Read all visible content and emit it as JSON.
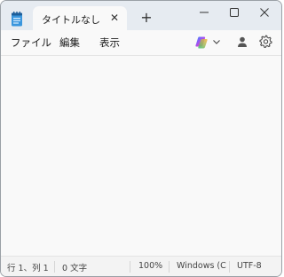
{
  "tab": {
    "title": "タイトルなし",
    "close_glyph": "✕"
  },
  "new_tab_glyph": "+",
  "menu": {
    "file": "ファイル",
    "edit": "編集",
    "view": "表示"
  },
  "status": {
    "position": "行 1、列 1",
    "characters": "0 文字",
    "zoom": "100%",
    "line_ending": "Windows (CR",
    "encoding": "UTF-8"
  },
  "colors": {
    "titlebar": "#e6ebf1",
    "editor_background": "#f9f9f9",
    "statusbar": "#f3f3f3",
    "app_icon": "#3a96dd"
  },
  "icons": {
    "app": "notepad-icon",
    "minimize": "minimize-icon",
    "maximize": "maximize-icon",
    "close": "close-icon",
    "copilot": "copilot-icon",
    "profile": "profile-icon",
    "settings": "gear-icon"
  }
}
